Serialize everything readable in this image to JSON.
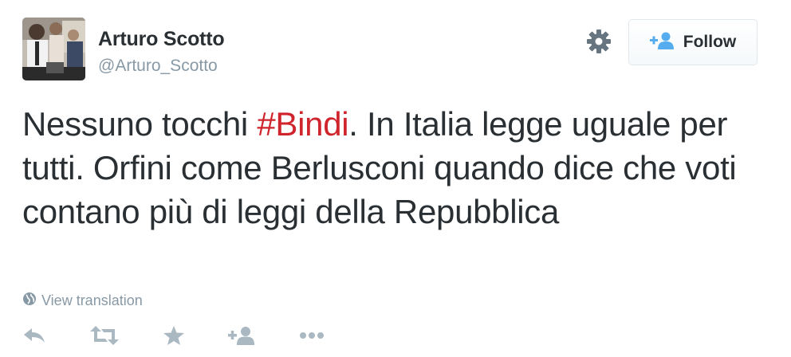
{
  "tweet": {
    "user": {
      "name": "Arturo Scotto",
      "handle": "@Arturo_Scotto"
    },
    "follow_button": {
      "label": "Follow",
      "icon": "add-user-icon"
    },
    "settings_icon": "gear-icon",
    "text": {
      "before": "Nessuno tocchi ",
      "hashtag": "#Bindi",
      "after": ". In Italia legge uguale per tutti. Orfini come Berlusconi quando dice che voti contano più di leggi della Repubblica"
    },
    "translation": {
      "label": "View translation",
      "icon": "globe-icon"
    },
    "actions": [
      "reply-icon",
      "retweet-icon",
      "favorite-icon",
      "follow-icon",
      "more-icon"
    ]
  },
  "colors": {
    "text": "#292f33",
    "muted": "#8899a6",
    "hashtag": "#d0242d",
    "icon": "#aab8c2",
    "border": "#e1e8ed"
  }
}
